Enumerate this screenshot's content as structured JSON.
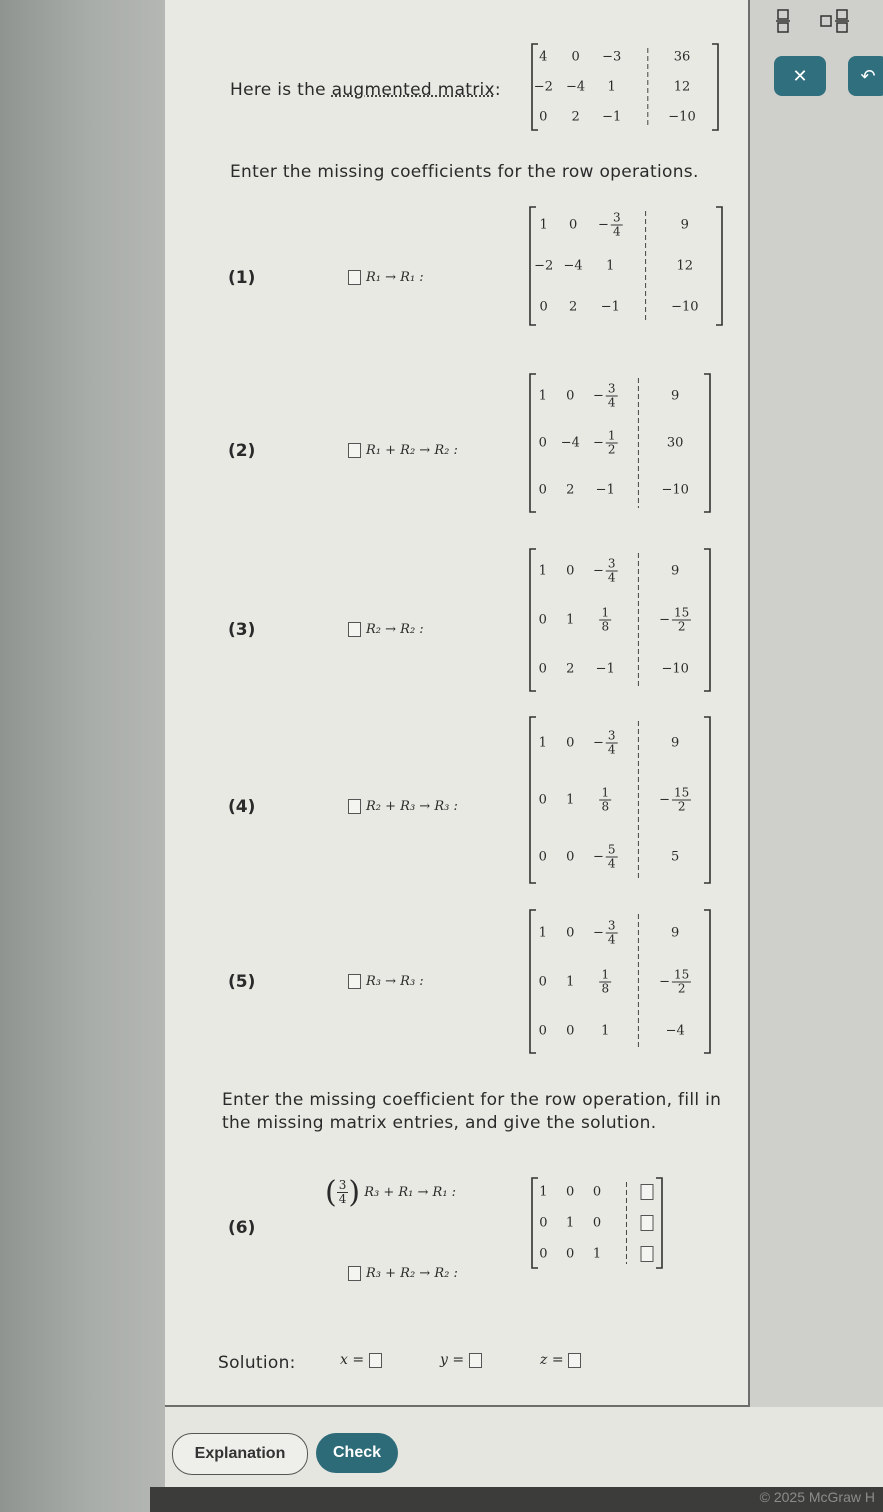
{
  "intro": {
    "prefix": "Here is the ",
    "link": "augmented matrix",
    "suffix": ":"
  },
  "instruction1": "Enter the missing coefficients for the row operations.",
  "instruction2_line1": "Enter the missing coefficient for the row operation, fill in",
  "instruction2_line2": "the missing matrix entries, and give the solution.",
  "augmented_matrix": [
    [
      "4",
      "0",
      "-3",
      "36"
    ],
    [
      "-2",
      "-4",
      "1",
      "12"
    ],
    [
      "0",
      "2",
      "-1",
      "-10"
    ]
  ],
  "steps": [
    {
      "label": "(1)",
      "operation": "R₁ → R₁ :",
      "matrix": [
        [
          "1",
          "0",
          "-3/4",
          "9"
        ],
        [
          "-2",
          "-4",
          "1",
          "12"
        ],
        [
          "0",
          "2",
          "-1",
          "-10"
        ]
      ]
    },
    {
      "label": "(2)",
      "operation": "R₁ + R₂ → R₂ :",
      "matrix": [
        [
          "1",
          "0",
          "-3/4",
          "9"
        ],
        [
          "0",
          "-4",
          "-1/2",
          "30"
        ],
        [
          "0",
          "2",
          "-1",
          "-10"
        ]
      ]
    },
    {
      "label": "(3)",
      "operation": "R₂ → R₂ :",
      "matrix": [
        [
          "1",
          "0",
          "-3/4",
          "9"
        ],
        [
          "0",
          "1",
          "1/8",
          "-15/2"
        ],
        [
          "0",
          "2",
          "-1",
          "-10"
        ]
      ]
    },
    {
      "label": "(4)",
      "operation": "R₂ + R₃ → R₃ :",
      "matrix": [
        [
          "1",
          "0",
          "-3/4",
          "9"
        ],
        [
          "0",
          "1",
          "1/8",
          "-15/2"
        ],
        [
          "0",
          "0",
          "-5/4",
          "5"
        ]
      ]
    },
    {
      "label": "(5)",
      "operation": "R₃ → R₃ :",
      "matrix": [
        [
          "1",
          "0",
          "-3/4",
          "9"
        ],
        [
          "0",
          "1",
          "1/8",
          "-15/2"
        ],
        [
          "0",
          "0",
          "1",
          "-4"
        ]
      ]
    }
  ],
  "step6": {
    "label": "(6)",
    "op1_coef": "3/4",
    "op1": "R₃ + R₁ → R₁ :",
    "op2": "R₃ + R₂ → R₂ :",
    "matrix": [
      [
        "1",
        "0",
        "0"
      ],
      [
        "0",
        "1",
        "0"
      ],
      [
        "0",
        "0",
        "1"
      ]
    ]
  },
  "solution": {
    "label": "Solution:",
    "x": "x =",
    "y": "y =",
    "z": "z ="
  },
  "buttons": {
    "explanation": "Explanation",
    "check": "Check"
  },
  "footer": "© 2025 McGraw H",
  "icons": {
    "chevron": "chevron-down-icon",
    "fraction": "fraction-icon",
    "mixed": "mixed-number-icon",
    "close": "close-icon"
  },
  "colors": {
    "accent": "#2d6b78",
    "page": "#e9e9e4"
  }
}
